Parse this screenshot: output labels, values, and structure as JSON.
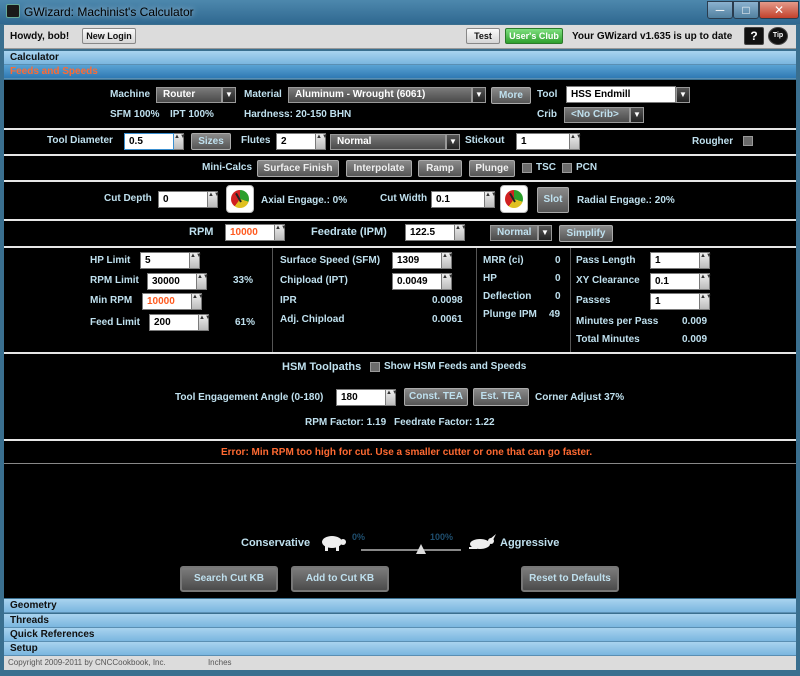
{
  "window": {
    "title": "GWizard: Machinist's Calculator",
    "min": "─",
    "max": "□",
    "close": "✕"
  },
  "topbar": {
    "greeting": "Howdy, bob!",
    "new_login": "New Login",
    "test": "Test",
    "users_club": "User's Club",
    "status": "Your GWizard v1.635 is up to date",
    "help": "?",
    "tip": "Tip"
  },
  "sections": {
    "calculator": "Calculator",
    "feeds_speeds": "Feeds and Speeds",
    "geometry": "Geometry",
    "threads": "Threads",
    "quick_refs": "Quick References",
    "setup": "Setup"
  },
  "machine": {
    "label": "Machine",
    "value": "Router",
    "material_label": "Material",
    "material": "Aluminum - Wrought (6061)",
    "more": "More",
    "tool_label": "Tool",
    "tool": "HSS Endmill",
    "sfm": "SFM 100%",
    "ipt": "IPT 100%",
    "hardness": "Hardness: 20-150 BHN",
    "crib_label": "Crib",
    "crib": "<No Crib>"
  },
  "tooldia": {
    "label": "Tool Diameter",
    "value": "0.5",
    "sizes": "Sizes",
    "flutes_label": "Flutes",
    "flutes": "2",
    "flute_type": "Normal",
    "stickout_label": "Stickout",
    "stickout": "1",
    "rougher": "Rougher"
  },
  "minicalcs": {
    "label": "Mini-Calcs",
    "surface_finish": "Surface Finish",
    "interpolate": "Interpolate",
    "ramp": "Ramp",
    "plunge": "Plunge",
    "tsc": "TSC",
    "pcn": "PCN"
  },
  "cut": {
    "depth_label": "Cut Depth",
    "depth": "0",
    "axial": "Axial Engage.: 0%",
    "width_label": "Cut Width",
    "width": "0.1",
    "slot": "Slot",
    "radial": "Radial Engage.: 20%"
  },
  "rpm": {
    "label": "RPM",
    "value": "10000",
    "feed_label": "Feedrate (IPM)",
    "feed": "122.5",
    "mode": "Normal",
    "simplify": "Simplify"
  },
  "limits": {
    "hp_label": "HP Limit",
    "hp": "5",
    "rpm_label": "RPM Limit",
    "rpm": "30000",
    "rpm_pct": "33%",
    "minrpm_label": "Min RPM",
    "minrpm": "10000",
    "feed_label": "Feed Limit",
    "feed": "200",
    "feed_pct": "61%"
  },
  "surface": {
    "sfm_label": "Surface Speed (SFM)",
    "sfm": "1309",
    "chip_label": "Chipload (IPT)",
    "chip": "0.0049",
    "ipr_label": "IPR",
    "ipr": "0.0098",
    "adj_label": "Adj. Chipload",
    "adj": "0.0061"
  },
  "mrr": {
    "mrr_label": "MRR (ci)",
    "mrr": "0",
    "hp_label": "HP",
    "hp": "0",
    "defl_label": "Deflection",
    "defl": "0",
    "plunge_label": "Plunge IPM",
    "plunge": "49"
  },
  "pass": {
    "len_label": "Pass Length",
    "len": "1",
    "xy_label": "XY Clearance",
    "xy": "0.1",
    "passes_label": "Passes",
    "passes": "1",
    "mpp_label": "Minutes per Pass",
    "mpp": "0.009",
    "total_label": "Total Minutes",
    "total": "0.009"
  },
  "hsm": {
    "title": "HSM Toolpaths",
    "show": "Show HSM Feeds and Speeds",
    "tea_label": "Tool Engagement Angle (0-180)",
    "tea": "180",
    "const": "Const. TEA",
    "est": "Est. TEA",
    "corner": "Corner Adjust 37%",
    "rpm_factor": "RPM Factor: 1.19",
    "feed_factor": "Feedrate Factor: 1.22"
  },
  "error": "Error: Min RPM too high for cut.  Use a smaller cutter or one that can go faster.",
  "slider": {
    "conservative": "Conservative",
    "aggressive": "Aggressive",
    "min": "0%",
    "max": "100%",
    "position_pct": 100
  },
  "buttons": {
    "search": "Search Cut KB",
    "add": "Add to Cut KB",
    "reset": "Reset to Defaults"
  },
  "footer": {
    "copyright": "Copyright 2009-2011 by CNCCookbook, Inc.",
    "units": "Inches"
  },
  "spin_arrows": "▲▼",
  "dd_arrow": "▼"
}
